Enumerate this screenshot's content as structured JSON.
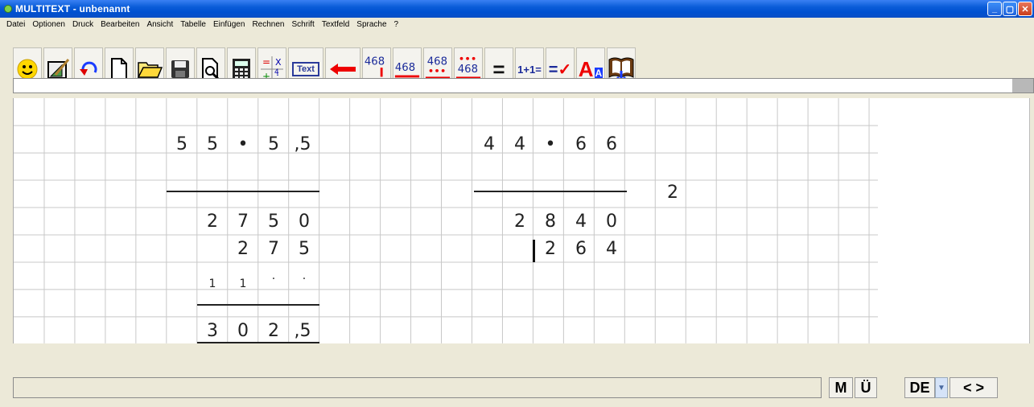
{
  "window": {
    "title": "MULTITEXT - unbenannt",
    "controls": [
      "minimize",
      "maximize",
      "close"
    ]
  },
  "menu": [
    "Datei",
    "Optionen",
    "Druck",
    "Bearbeiten",
    "Ansicht",
    "Tabelle",
    "Einfügen",
    "Rechnen",
    "Schrift",
    "Textfeld",
    "Sprache",
    "?"
  ],
  "toolbar": [
    {
      "name": "smiley-icon",
      "label": ""
    },
    {
      "name": "geometry-icon",
      "label": ""
    },
    {
      "name": "undo-icon",
      "label": ""
    },
    {
      "name": "new-document-icon",
      "label": ""
    },
    {
      "name": "open-folder-icon",
      "label": ""
    },
    {
      "name": "save-icon",
      "label": ""
    },
    {
      "name": "print-preview-icon",
      "label": ""
    },
    {
      "name": "calculator-icon",
      "label": ""
    },
    {
      "name": "operators-icon",
      "label": ""
    },
    {
      "name": "text-box-icon",
      "label": "Text"
    },
    {
      "name": "arrow-left-icon",
      "label": ""
    },
    {
      "name": "number-468-a-icon",
      "label": "468"
    },
    {
      "name": "number-468-b-icon",
      "label": "468"
    },
    {
      "name": "number-468-c-icon",
      "label": "468"
    },
    {
      "name": "number-468-d-icon",
      "label": "468"
    },
    {
      "name": "equals-icon",
      "label": "="
    },
    {
      "name": "one-plus-one-icon",
      "label": "1+1="
    },
    {
      "name": "equals-check-icon",
      "label": "=✓"
    },
    {
      "name": "font-size-icon",
      "label": "A"
    },
    {
      "name": "book-icon",
      "label": ""
    }
  ],
  "worksheet": {
    "problem1": {
      "row1": [
        "5",
        "5",
        "•",
        "5",
        ",5"
      ],
      "row2": [
        "2",
        "7",
        "5",
        "0"
      ],
      "row3": [
        "2",
        "7",
        "5"
      ],
      "row4": [
        "1",
        "1",
        "·",
        "·"
      ],
      "row5": [
        "3",
        "0",
        "2",
        ",5"
      ]
    },
    "problem2": {
      "row1": [
        "4",
        "4",
        "•",
        "6",
        "6"
      ],
      "side": "2",
      "row2": [
        "2",
        "8",
        "4",
        "0"
      ],
      "row3": [
        "2",
        "6",
        "4"
      ]
    }
  },
  "statusbar": {
    "buttons": [
      "M",
      "Ü"
    ],
    "language": "DE",
    "nav": "< >"
  }
}
